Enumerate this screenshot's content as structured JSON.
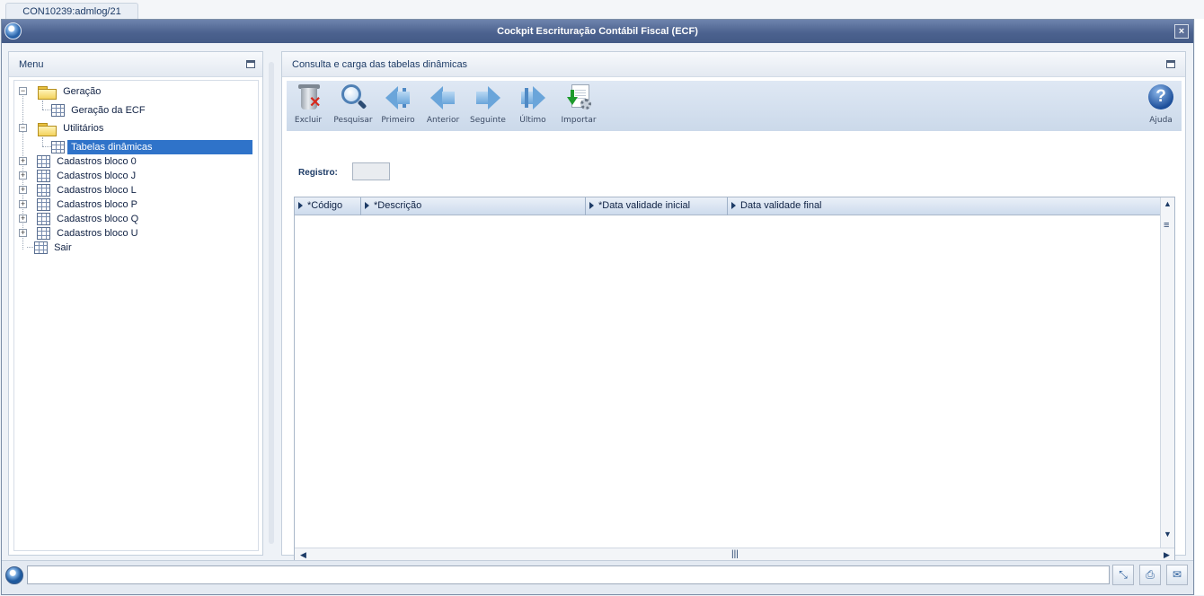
{
  "session": {
    "tab_label": "CON10239:admlog/21"
  },
  "window": {
    "title": "Cockpit Escrituração Contábil Fiscal (ECF)",
    "close_symbol": "×"
  },
  "menu": {
    "title": "Menu",
    "items": [
      {
        "label": "Geração",
        "type": "folder",
        "expander": "−"
      },
      {
        "label": "Geração da ECF",
        "type": "table"
      },
      {
        "label": "Utilitários",
        "type": "folder",
        "expander": "−"
      },
      {
        "label": "Tabelas dinâmicas",
        "type": "table",
        "selected": true
      },
      {
        "label": "Cadastros bloco 0",
        "type": "table",
        "expander": "+"
      },
      {
        "label": "Cadastros bloco J",
        "type": "table",
        "expander": "+"
      },
      {
        "label": "Cadastros bloco L",
        "type": "table",
        "expander": "+"
      },
      {
        "label": "Cadastros bloco P",
        "type": "table",
        "expander": "+"
      },
      {
        "label": "Cadastros bloco Q",
        "type": "table",
        "expander": "+"
      },
      {
        "label": "Cadastros bloco U",
        "type": "table",
        "expander": "+"
      },
      {
        "label": "Sair",
        "type": "table"
      }
    ]
  },
  "content": {
    "title": "Consulta e carga das tabelas dinâmicas",
    "toolbar": {
      "excluir": "Excluir",
      "pesquisar": "Pesquisar",
      "primeiro": "Primeiro",
      "anterior": "Anterior",
      "seguinte": "Seguinte",
      "ultimo": "Último",
      "importar": "Importar",
      "ajuda": "Ajuda"
    },
    "registro_label": "Registro:",
    "registro_value": "",
    "grid": {
      "columns": [
        "*Código",
        "*Descrição",
        "*Data validade inicial",
        "Data validade final"
      ],
      "rows": []
    }
  },
  "colors": {
    "title_bar": "#4c628f",
    "selection": "#2f73c9",
    "toolbar": "#cbd9ea"
  },
  "icons": [
    "trash-icon",
    "magnifier-icon",
    "first-arrow-icon",
    "previous-arrow-icon",
    "next-arrow-icon",
    "last-arrow-icon",
    "import-icon",
    "help-icon",
    "folder-icon",
    "table-icon"
  ]
}
